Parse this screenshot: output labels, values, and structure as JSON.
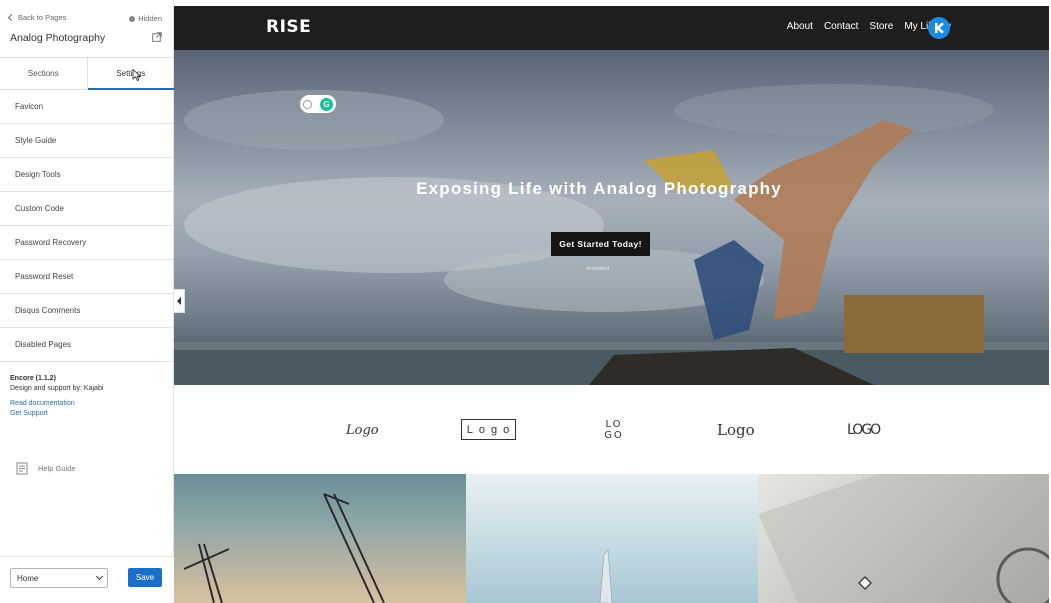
{
  "sidebar": {
    "back_label": "Back to Pages",
    "visibility_label": "Hidden",
    "site_title": "Analog Photography",
    "tabs": [
      {
        "label": "Sections"
      },
      {
        "label": "Settings"
      }
    ],
    "settings_items": [
      {
        "label": "Favicon"
      },
      {
        "label": "Style Guide"
      },
      {
        "label": "Design Tools"
      },
      {
        "label": "Custom Code"
      },
      {
        "label": "Password Recovery"
      },
      {
        "label": "Password Reset"
      },
      {
        "label": "Disqus Comments"
      },
      {
        "label": "Disabled Pages"
      }
    ],
    "theme": {
      "name": "Encore (1.1.2)",
      "credit": "Design and support by: Kajabi",
      "docs_link": "Read documentation",
      "support_link": "Get Support"
    },
    "help_guide_label": "Help Guide",
    "footer": {
      "page_select_value": "Home",
      "save_label": "Save",
      "save_color": "#1a6fc9"
    }
  },
  "preview": {
    "brand_logo": "RISE",
    "nav": [
      {
        "label": "About"
      },
      {
        "label": "Contact"
      },
      {
        "label": "Store"
      },
      {
        "label": "My Library"
      }
    ],
    "avatar_icon": "kajabi-logo-icon",
    "avatar_color": "#1a8ce3",
    "hero": {
      "heading": "Exposing Life with Analog Photography",
      "cta_label": "Get Started Today!",
      "caption": "Animated"
    },
    "logos": [
      {
        "text": "Logo"
      },
      {
        "text": "Logo"
      },
      {
        "text": "LOGO"
      },
      {
        "text": "Logo"
      },
      {
        "text": "LOGO"
      }
    ]
  }
}
